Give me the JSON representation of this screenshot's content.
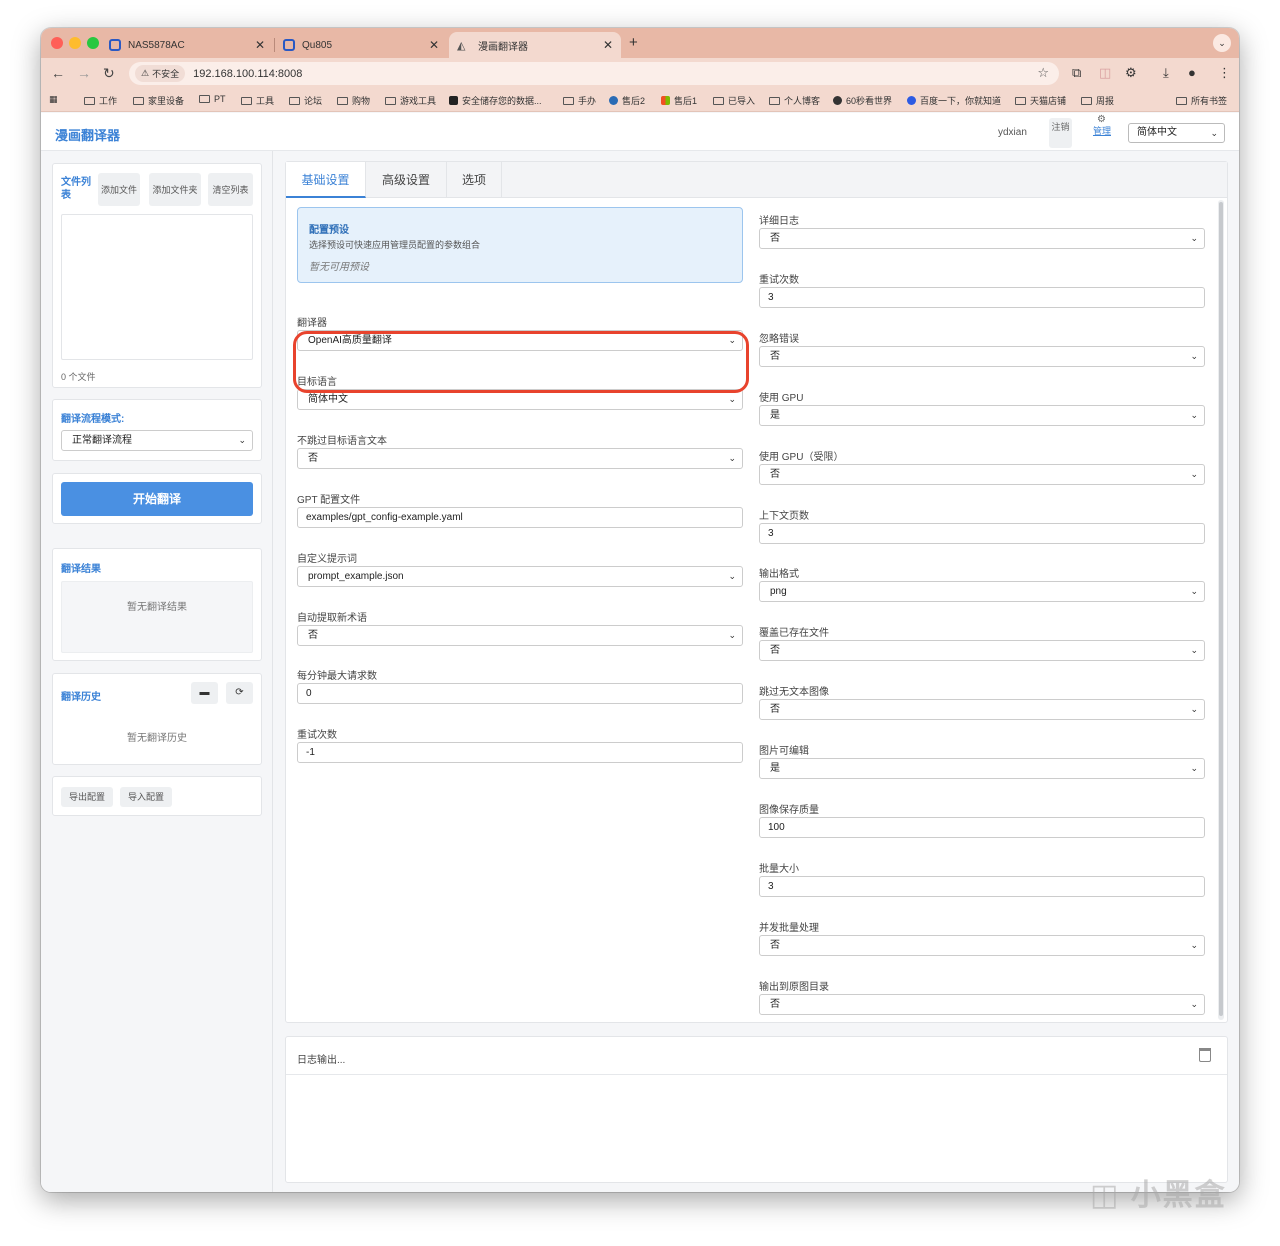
{
  "browser": {
    "tabs": [
      {
        "title": "NAS5878AC",
        "active": false
      },
      {
        "title": "Qu805",
        "active": false
      },
      {
        "title": "漫画翻译器",
        "active": true
      }
    ],
    "security_label": "不安全",
    "url": "192.168.100.114:8008",
    "bookmarks": [
      "工作",
      "家里设备",
      "PT",
      "工具",
      "论坛",
      "购物",
      "游戏工具",
      "安全储存您的数据...",
      "手办",
      "售后2",
      "售后1",
      "已导入",
      "个人博客",
      "60秒看世界",
      "百度一下，你就知道",
      "天猫店铺",
      "周报",
      "所有书签"
    ]
  },
  "header": {
    "app_title": "漫画翻译器",
    "username": "ydxian",
    "logout_label": "注销",
    "admin_label": "管理",
    "ui_language": "简体中文"
  },
  "sidebar": {
    "file_list_title": "文件列表",
    "add_file_label": "添加文件",
    "add_folder_label": "添加文件夹",
    "clear_list_label": "清空列表",
    "file_count": "0 个文件",
    "workflow_label": "翻译流程模式:",
    "workflow_value": "正常翻译流程",
    "start_button": "开始翻译",
    "results_title": "翻译结果",
    "results_empty": "暂无翻译结果",
    "history_title": "翻译历史",
    "history_empty": "暂无翻译历史",
    "export_config": "导出配置",
    "import_config": "导入配置"
  },
  "main": {
    "tabs": [
      "基础设置",
      "高级设置",
      "选项"
    ],
    "active_tab": "基础设置",
    "preset": {
      "title": "配置预设",
      "description": "选择预设可快速应用管理员配置的参数组合",
      "empty": "暂无可用预设"
    },
    "left_fields": [
      {
        "label": "翻译器",
        "value": "OpenAI高质量翻译",
        "type": "select"
      },
      {
        "label": "目标语言",
        "value": "简体中文",
        "type": "select"
      },
      {
        "label": "不跳过目标语言文本",
        "value": "否",
        "type": "select"
      },
      {
        "label": "GPT 配置文件",
        "value": "examples/gpt_config-example.yaml",
        "type": "input"
      },
      {
        "label": "自定义提示词",
        "value": "prompt_example.json",
        "type": "select"
      },
      {
        "label": "自动提取新术语",
        "value": "否",
        "type": "select"
      },
      {
        "label": "每分钟最大请求数",
        "value": "0",
        "type": "input"
      },
      {
        "label": "重试次数",
        "value": "-1",
        "type": "input"
      }
    ],
    "right_fields": [
      {
        "label": "详细日志",
        "value": "否",
        "type": "select"
      },
      {
        "label": "重试次数",
        "value": "3",
        "type": "input"
      },
      {
        "label": "忽略错误",
        "value": "否",
        "type": "select"
      },
      {
        "label": "使用 GPU",
        "value": "是",
        "type": "select"
      },
      {
        "label": "使用 GPU（受限）",
        "value": "否",
        "type": "select"
      },
      {
        "label": "上下文页数",
        "value": "3",
        "type": "input"
      },
      {
        "label": "输出格式",
        "value": "png",
        "type": "select"
      },
      {
        "label": "覆盖已存在文件",
        "value": "否",
        "type": "select"
      },
      {
        "label": "跳过无文本图像",
        "value": "否",
        "type": "select"
      },
      {
        "label": "图片可编辑",
        "value": "是",
        "type": "select"
      },
      {
        "label": "图像保存质量",
        "value": "100",
        "type": "input"
      },
      {
        "label": "批量大小",
        "value": "3",
        "type": "input"
      },
      {
        "label": "并发批量处理",
        "value": "否",
        "type": "select"
      },
      {
        "label": "输出到原图目录",
        "value": "否",
        "type": "select"
      }
    ]
  },
  "log": {
    "title": "日志输出..."
  },
  "watermark": "小黑盒",
  "colors": {
    "accent": "#3b82d6",
    "primary_button": "#4a90e2",
    "highlight_ring": "#e8432d",
    "tabstrip": "#e8b8a6"
  }
}
